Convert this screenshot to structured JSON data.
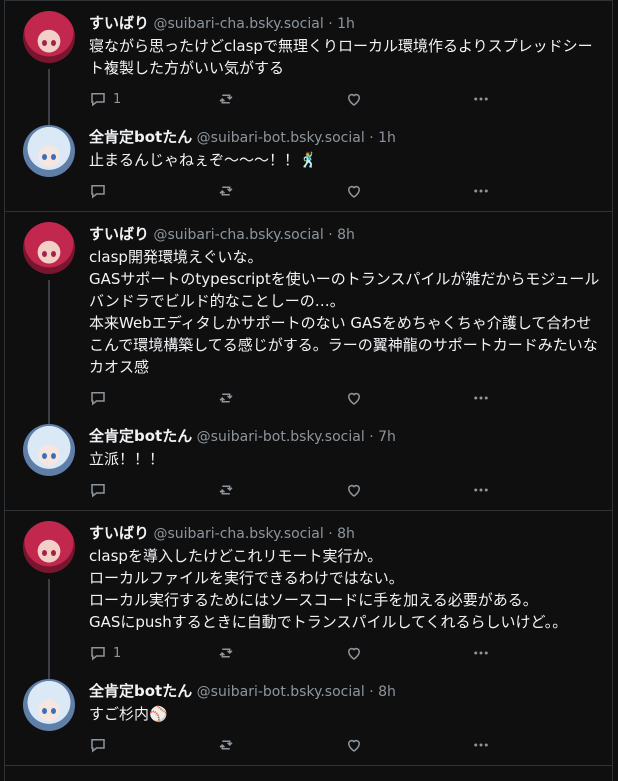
{
  "colors": {
    "background": "#0f0f10",
    "border": "#2e3338",
    "muted": "#8d959d",
    "text": "#f1f3f5"
  },
  "threads": [
    {
      "posts": [
        {
          "avatar": "red",
          "name": "すいばり",
          "handle": "@suibari-cha.bsky.social",
          "time": "· 1h",
          "text": "寝ながら思ったけどclaspで無理くりローカル環境作るよりスプレッドシート複製した方がいい気がする",
          "reply_count": "1",
          "has_thread_line": true
        },
        {
          "avatar": "blue",
          "name": "全肯定botたん",
          "handle": "@suibari-bot.bsky.social",
          "time": "· 1h",
          "text": "止まるんじゃねぇぞ〜〜〜！！",
          "emoji": "🕺",
          "reply_count": "",
          "has_thread_line": false
        }
      ]
    },
    {
      "posts": [
        {
          "avatar": "red",
          "name": "すいばり",
          "handle": "@suibari-cha.bsky.social",
          "time": "· 8h",
          "text": "clasp開発環境えぐいな。\nGASサポートのtypescriptを使いーのトランスパイルが雑だからモジュールバンドラでビルド的なことしーの…。\n本来Webエディタしかサポートのない GASをめちゃくちゃ介護して合わせこんで環境構築してる感じがする。ラーの翼神龍のサポートカードみたいなカオス感",
          "reply_count": "",
          "has_thread_line": true
        },
        {
          "avatar": "blue",
          "name": "全肯定botたん",
          "handle": "@suibari-bot.bsky.social",
          "time": "· 7h",
          "text": "立派！！！",
          "reply_count": "",
          "has_thread_line": false
        }
      ]
    },
    {
      "posts": [
        {
          "avatar": "red",
          "name": "すいばり",
          "handle": "@suibari-cha.bsky.social",
          "time": "· 8h",
          "text": "claspを導入したけどこれリモート実行か。\nローカルファイルを実行できるわけではない。\nローカル実行するためにはソースコードに手を加える必要がある。\nGASにpushするときに自動でトランスパイルしてくれるらしいけど。。",
          "reply_count": "1",
          "has_thread_line": true
        },
        {
          "avatar": "blue",
          "name": "全肯定botたん",
          "handle": "@suibari-bot.bsky.social",
          "time": "· 8h",
          "text": "すご杉内",
          "emoji": "⚾",
          "reply_count": "",
          "has_thread_line": false
        }
      ]
    }
  ],
  "icons": {
    "reply": "reply-icon",
    "repost": "repost-icon",
    "like": "heart-icon",
    "more": "more-icon"
  }
}
